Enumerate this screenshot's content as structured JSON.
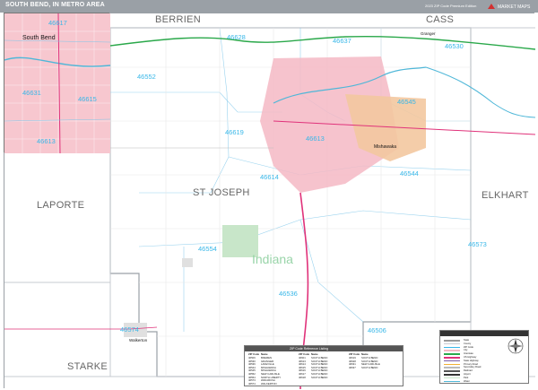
{
  "header": {
    "title": "SOUTH BEND, IN METRO AREA",
    "edition": "2023 ZIP Code Premium Edition",
    "publisher_logo": "MARKET MAPS"
  },
  "map": {
    "counties": {
      "berrien": "BERRIEN",
      "cass": "CASS",
      "laporte": "LAPORTE",
      "st_joseph": "ST JOSEPH",
      "elkhart": "ELKHART",
      "starke": "STARKE"
    },
    "state_label": "Indiana",
    "zips": {
      "z46617_inset": "46617",
      "z46628": "46628",
      "z46637": "46637",
      "z46530": "46530",
      "z46552": "46552",
      "z46631": "46631",
      "z46615_inset": "46615",
      "z46613_inset": "46613",
      "z46619": "46619",
      "z46613": "46613",
      "z46545": "46545",
      "z46614": "46614",
      "z46544": "46544",
      "z46554": "46554",
      "z46573": "46573",
      "z46536": "46536",
      "z46506": "46506",
      "z46574": "46574",
      "z46615": "46615",
      "z46601": "46601"
    },
    "cities": {
      "south_bend_inset": "South Bend",
      "mishawaka": "Mishawaka",
      "granger": "Granger",
      "walkerton": "Walkerton"
    }
  },
  "legend": {
    "title": "",
    "rows": [
      "State",
      "County",
      "ZIP Code",
      "City",
      "Interstate",
      "US Highway",
      "State Highway",
      "Primary Road",
      "Secondary Road",
      "Railroad",
      "Airport",
      "Park",
      "Water"
    ]
  },
  "zip_table": {
    "title": "ZIP Code Reference Listing",
    "headers": [
      "ZIP Code",
      "Name",
      "ZIP Code",
      "Name",
      "ZIP Code",
      "Name"
    ],
    "rows": [
      [
        "46506",
        "BREMEN",
        "46601",
        "SOUTH BEND",
        "46619",
        "SOUTH BEND"
      ],
      [
        "46530",
        "GRANGER",
        "46613",
        "SOUTH BEND",
        "46628",
        "SOUTH BEND"
      ],
      [
        "46536",
        "LAKEVILLE",
        "46614",
        "SOUTH BEND",
        "46631",
        "NEW CARLISLE"
      ],
      [
        "46544",
        "MISHAWAKA",
        "46615",
        "SOUTH BEND",
        "46637",
        "SOUTH BEND"
      ],
      [
        "46545",
        "MISHAWAKA",
        "46616",
        "SOUTH BEND",
        "",
        ""
      ],
      [
        "46552",
        "NEW CARLISLE",
        "46617",
        "SOUTH BEND",
        "",
        ""
      ],
      [
        "46554",
        "NORTH LIBERTY",
        "46618",
        "SOUTH BEND",
        "",
        ""
      ],
      [
        "46573",
        "WAKARUSA",
        "",
        "",
        "",
        ""
      ],
      [
        "46574",
        "WALKERTON",
        "",
        "",
        "",
        ""
      ]
    ]
  },
  "colors": {
    "titlebar": "#9aa0a6",
    "zip_text": "#38b7e8",
    "urban": "#f4b9c4",
    "mishawaka_urban": "#f3c8a0",
    "county_line": "#c7cbd1",
    "interstate": "#2aa84a",
    "us_highway": "#e0327a",
    "water": "#4fb7d8",
    "park": "#c8e6c9"
  }
}
